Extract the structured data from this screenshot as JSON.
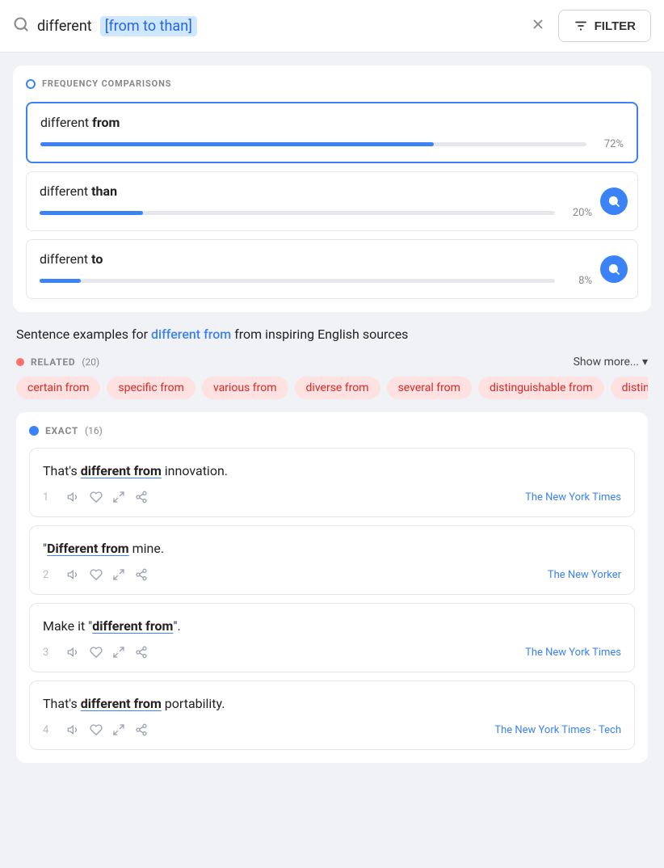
{
  "search": {
    "base_text": "different",
    "highlight_text": "[from to than]",
    "clear_label": "×",
    "filter_label": "FILTER"
  },
  "frequency": {
    "section_title": "FREQUENCY COMPARISONS",
    "items": [
      {
        "base": "different ",
        "keyword": "from",
        "pct": 72,
        "pct_label": "72%",
        "active": true,
        "has_search": false
      },
      {
        "base": "different ",
        "keyword": "than",
        "pct": 20,
        "pct_label": "20%",
        "active": false,
        "has_search": true
      },
      {
        "base": "different ",
        "keyword": "to",
        "pct": 8,
        "pct_label": "8%",
        "active": false,
        "has_search": true
      }
    ]
  },
  "sentences_section": {
    "heading_pre": "Sentence examples for",
    "heading_phrase": "different from",
    "heading_post": "from inspiring English sources"
  },
  "related": {
    "label": "RELATED",
    "count": "(20)",
    "show_more_label": "Show more...",
    "tags": [
      "certain from",
      "specific from",
      "various from",
      "diverse from",
      "several from",
      "distinguishable from",
      "distinct"
    ]
  },
  "exact": {
    "label": "EXACT",
    "count": "(16)",
    "sentences": [
      {
        "num": "1",
        "text_pre": "That's ",
        "text_bold": "different from",
        "text_post": " innovation.",
        "source": "The New York Times"
      },
      {
        "num": "2",
        "text_pre": "\"",
        "text_bold": "Different from",
        "text_post": " mine.",
        "source": "The New Yorker"
      },
      {
        "num": "3",
        "text_pre": "Make it \"",
        "text_bold": "different from",
        "text_post": "\".",
        "source": "The New York Times"
      },
      {
        "num": "4",
        "text_pre": "That's ",
        "text_bold": "different from",
        "text_post": " portability.",
        "source": "The New York Times - Tech"
      }
    ]
  }
}
